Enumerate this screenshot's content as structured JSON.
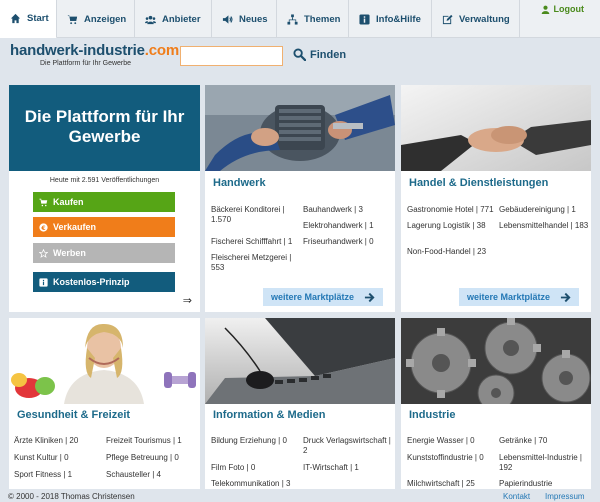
{
  "nav": {
    "tabs": [
      {
        "label": "Start",
        "icon": "home-icon"
      },
      {
        "label": "Anzeigen",
        "icon": "cart-icon"
      },
      {
        "label": "Anbieter",
        "icon": "users-icon"
      },
      {
        "label": "Neues",
        "icon": "speaker-icon"
      },
      {
        "label": "Themen",
        "icon": "sitemap-icon"
      },
      {
        "label": "Info&Hilfe",
        "icon": "info-icon"
      },
      {
        "label": "Verwaltung",
        "icon": "edit-icon"
      }
    ],
    "logout": "Logout"
  },
  "header": {
    "logo_main": "handwerk-industrie",
    "logo_tld": ".com",
    "tagline": "Die Plattform für Ihr Gewerbe",
    "search_value": "",
    "search_label": "Finden"
  },
  "hero": {
    "title": "Die Plattform für Ihr Gewerbe",
    "count_text": "Heute mit 2.591 Veröffentlichungen",
    "buttons": [
      {
        "label": "Kaufen",
        "icon": "cart-icon",
        "color": "#56a516"
      },
      {
        "label": "Verkaufen",
        "icon": "euro-icon",
        "color": "#f07d1a"
      },
      {
        "label": "Werben",
        "icon": "star-icon",
        "color": "#b5b5b5"
      },
      {
        "label": "Kostenlos-Prinzip",
        "icon": "info-icon",
        "color": "#125c7d"
      }
    ],
    "arrow": "⇒"
  },
  "categories": [
    {
      "title": "Handwerk",
      "items": [
        "Bäckerei Konditorei | 1.570",
        "Bauhandwerk | 3",
        "Elektrohandwerk | 1",
        "Fischerei Schifffahrt | 1",
        "Friseurhandwerk | 0",
        "Fleischerei Metzgerei | 553"
      ],
      "more": "weitere Marktplätze"
    },
    {
      "title": "Handel & Dienstleistungen",
      "items": [
        "Gastronomie Hotel | 771",
        "Gebäudereinigung | 1",
        "Lagerung Logistik | 38",
        "Lebensmittelhandel | 183",
        "Non-Food-Handel | 23"
      ],
      "more": "weitere Marktplätze"
    },
    {
      "title": "Gesundheit & Freizeit",
      "items": [
        "Ärzte Kliniken | 20",
        "Freizeit Tourismus | 1",
        "Kunst Kultur | 0",
        "Pflege Betreuung | 0",
        "Sport Fitness | 1",
        "Schausteller | 4"
      ]
    },
    {
      "title": "Information & Medien",
      "items": [
        "Bildung Erziehung | 0",
        "Druck Verlagswirtschaft | 2",
        "Film Foto | 0",
        "IT-Wirtschaft | 1",
        "Telekommunikation | 3"
      ]
    },
    {
      "title": "Industrie",
      "items": [
        "Energie Wasser | 0",
        "Getränke | 70",
        "Kunststoffindustrie | 0",
        "Lebensmittel-Industrie | 192",
        "Milchwirtschaft | 25",
        "Papierindustrie"
      ]
    }
  ],
  "footer": {
    "copyright": "© 2000 - 2018 Thomas Christensen",
    "links": [
      "Kontakt",
      "Impressum"
    ]
  },
  "colors": {
    "brand_blue": "#125c7d",
    "accent_orange": "#f07d1a",
    "green": "#56a516",
    "link_blue": "#2478b5"
  }
}
